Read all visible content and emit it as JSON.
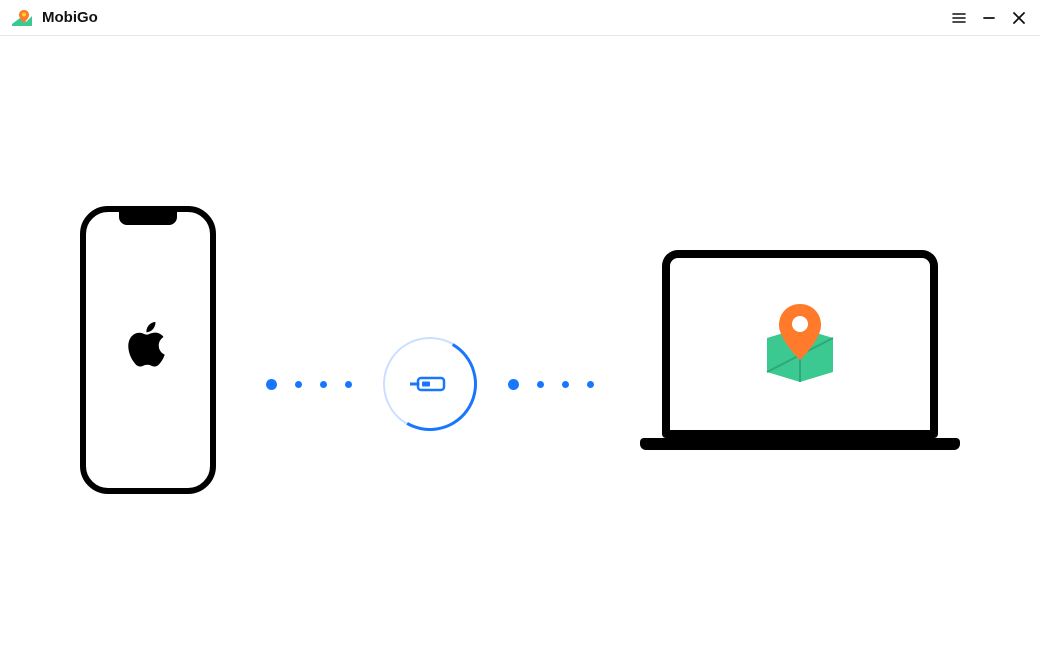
{
  "header": {
    "app_name": "MobiGo"
  },
  "icons": {
    "logo": "mobigo-logo",
    "menu": "hamburger-menu",
    "minimize": "window-minimize",
    "close": "window-close",
    "phone_brand": "apple-logo",
    "cable": "usb-cable",
    "laptop_app": "location-pin-map"
  },
  "colors": {
    "accent": "#1976ff",
    "pin": "#ff7a2b",
    "map": "#3cc891"
  }
}
